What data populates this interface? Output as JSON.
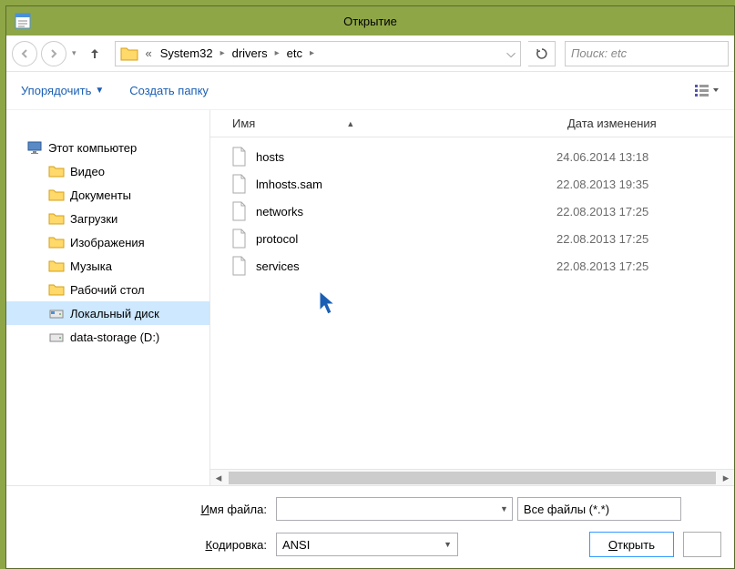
{
  "window": {
    "title": "Открытие"
  },
  "nav": {
    "back_tip": "Назад",
    "forward_tip": "Вперёд",
    "up_tip": "Вверх"
  },
  "breadcrumbs": [
    "System32",
    "drivers",
    "etc"
  ],
  "search": {
    "placeholder": "Поиск: etc"
  },
  "toolbar": {
    "organize": "Упорядочить",
    "new_folder": "Создать папку"
  },
  "tree": {
    "root": "Этот компьютер",
    "items": [
      "Видео",
      "Документы",
      "Загрузки",
      "Изображения",
      "Музыка",
      "Рабочий стол",
      "Локальный диск",
      "data-storage (D:)"
    ]
  },
  "columns": {
    "name": "Имя",
    "date": "Дата изменения"
  },
  "files": [
    {
      "name": "hosts",
      "date": "24.06.2014 13:18"
    },
    {
      "name": "lmhosts.sam",
      "date": "22.08.2013 19:35"
    },
    {
      "name": "networks",
      "date": "22.08.2013 17:25"
    },
    {
      "name": "protocol",
      "date": "22.08.2013 17:25"
    },
    {
      "name": "services",
      "date": "22.08.2013 17:25"
    }
  ],
  "bottom": {
    "filename_label_pre": "Имя файла:",
    "filename_underline": "И",
    "filename_label_rest": "мя файла:",
    "filename_value": "",
    "filter_value": "Все файлы  (*.*)",
    "encoding_underline": "К",
    "encoding_label_rest": "одировка:",
    "encoding_value": "ANSI",
    "open_label": "Открыть",
    "open_underline": "О",
    "open_rest": "ткрыть"
  }
}
